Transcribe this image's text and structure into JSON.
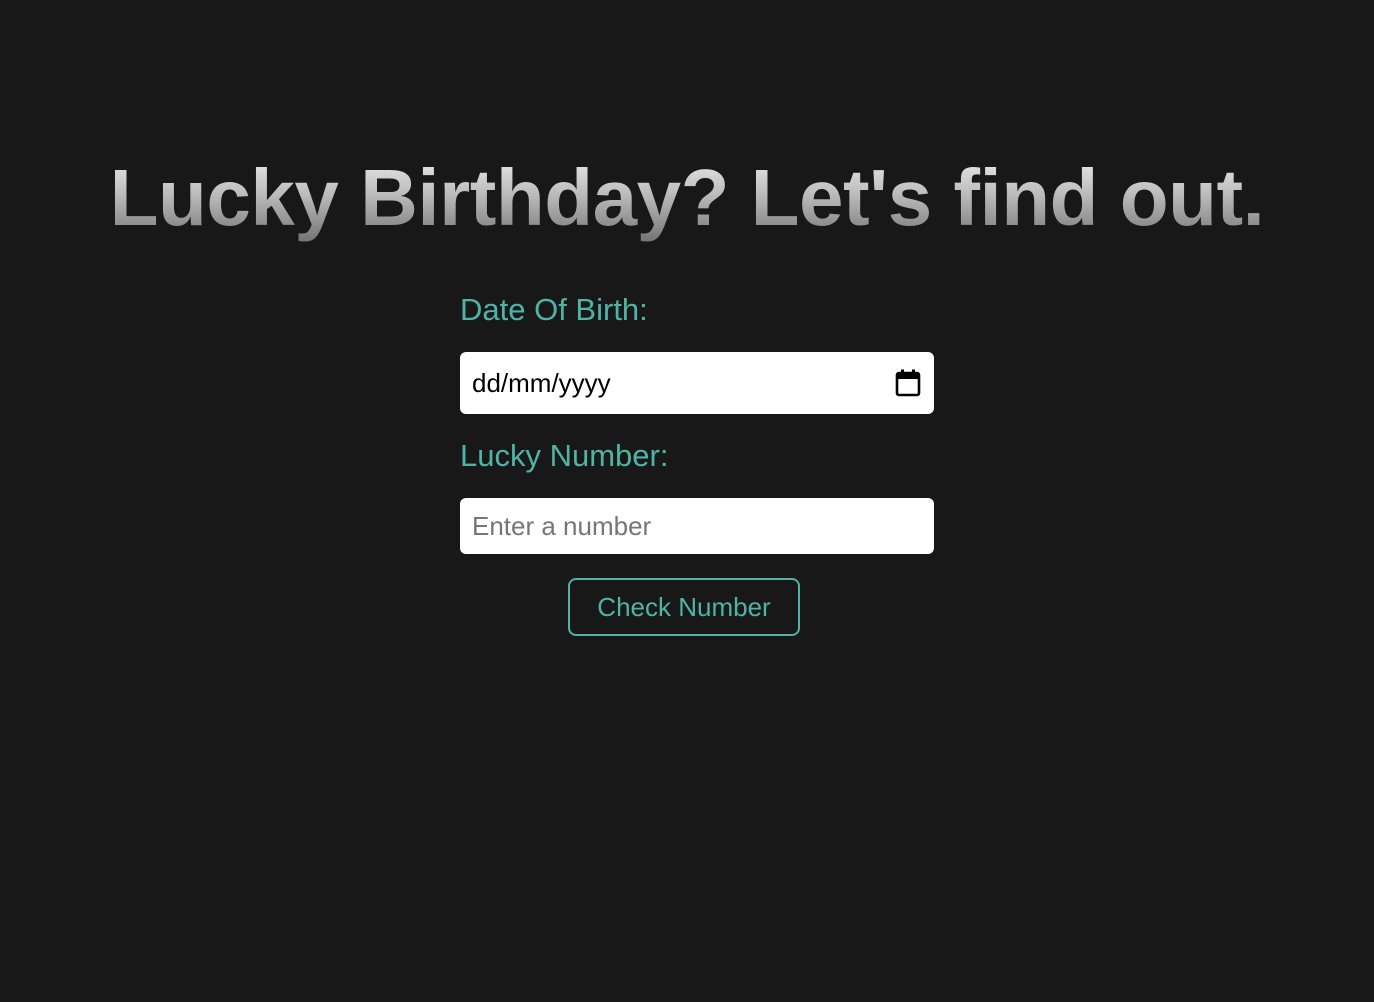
{
  "header": {
    "title": "Lucky Birthday? Let's find out."
  },
  "form": {
    "dob_label": "Date Of Birth:",
    "dob_value": "dd/mm/yyyy",
    "lucky_label": "Lucky Number:",
    "lucky_placeholder": "Enter a number",
    "submit_label": "Check Number"
  },
  "icons": {
    "date_picker": "calendar-icon"
  },
  "colors": {
    "background": "#181818",
    "accent": "#4fb3a6",
    "input_background": "#ffffff"
  }
}
